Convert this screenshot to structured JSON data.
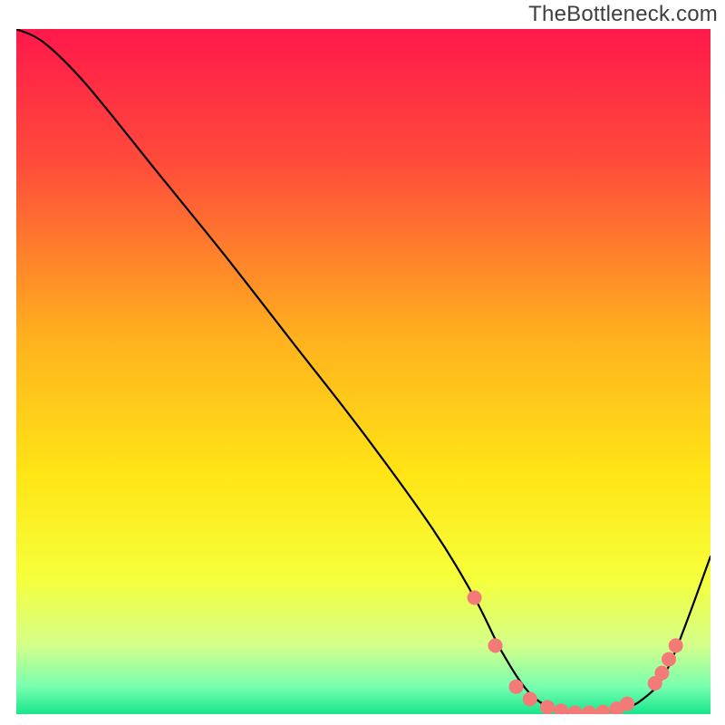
{
  "watermark": "TheBottleneck.com",
  "chart_data": {
    "type": "line",
    "title": "",
    "xlabel": "",
    "ylabel": "",
    "xlim": [
      0,
      100
    ],
    "ylim": [
      0,
      100
    ],
    "gradient_stops": [
      {
        "offset": 0.0,
        "color": "#ff184b"
      },
      {
        "offset": 0.2,
        "color": "#ff4d3a"
      },
      {
        "offset": 0.45,
        "color": "#ffb11e"
      },
      {
        "offset": 0.65,
        "color": "#ffe516"
      },
      {
        "offset": 0.8,
        "color": "#f6ff3a"
      },
      {
        "offset": 0.9,
        "color": "#d3ff8a"
      },
      {
        "offset": 0.96,
        "color": "#78ffb0"
      },
      {
        "offset": 1.0,
        "color": "#18e58c"
      }
    ],
    "series": [
      {
        "name": "bottleneck-curve",
        "x": [
          0,
          4,
          10,
          20,
          30,
          40,
          50,
          60,
          66,
          70,
          74,
          78,
          82,
          86,
          90,
          94,
          100
        ],
        "y": [
          100,
          98,
          92,
          79.5,
          67,
          54,
          41,
          27,
          17,
          9,
          3,
          0.5,
          0,
          0.5,
          2,
          7,
          23
        ]
      }
    ],
    "markers": {
      "name": "trough-dots",
      "color": "#f47a78",
      "radius_px": 8,
      "points": [
        {
          "x": 66,
          "y": 17
        },
        {
          "x": 69,
          "y": 10
        },
        {
          "x": 72,
          "y": 4
        },
        {
          "x": 74,
          "y": 2.2
        },
        {
          "x": 76.5,
          "y": 1
        },
        {
          "x": 78.5,
          "y": 0.5
        },
        {
          "x": 80.5,
          "y": 0.2
        },
        {
          "x": 82.5,
          "y": 0.2
        },
        {
          "x": 84.5,
          "y": 0.3
        },
        {
          "x": 86.5,
          "y": 0.8
        },
        {
          "x": 88,
          "y": 1.5
        },
        {
          "x": 92,
          "y": 4.5
        },
        {
          "x": 93,
          "y": 6
        },
        {
          "x": 94,
          "y": 8
        },
        {
          "x": 95,
          "y": 10
        }
      ]
    }
  }
}
